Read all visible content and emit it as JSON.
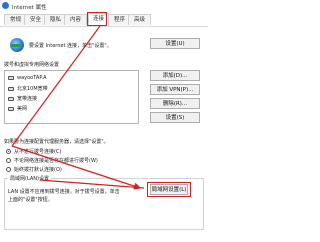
{
  "window": {
    "title": "Internet 属性"
  },
  "tabs": [
    {
      "label": "常规",
      "active": false
    },
    {
      "label": "安全",
      "active": false
    },
    {
      "label": "隐私",
      "active": false
    },
    {
      "label": "内容",
      "active": false
    },
    {
      "label": "连接",
      "active": true
    },
    {
      "label": "程序",
      "active": false
    },
    {
      "label": "高级",
      "active": false
    }
  ],
  "setup": {
    "text": "要设置 Internet 连接，单击\"设置\"。",
    "button": "设置(U)"
  },
  "dialup": {
    "label": "拨号和虚拟专用网络设置",
    "items": [
      "wayooTAP.A",
      "北京10M宽带",
      "宽带连接",
      "美网"
    ],
    "buttons": [
      "添加(D)...",
      "添加 VPN(P)...",
      "删除(R)...",
      "设置(S)"
    ]
  },
  "proxy_note": "如果要为连接配置代理服务器，请选择\"设置\"。",
  "radios": [
    {
      "label": "从不进行拨号连接(C)",
      "checked": true
    },
    {
      "label": "不论网络连接是否存在都进行拨号(W)",
      "checked": false
    },
    {
      "label": "始终拨打默认连接(O)",
      "checked": false
    }
  ],
  "lan": {
    "group_title": "局域网(LAN)设置",
    "text_line1": "LAN 设置不应用到拨号连接。对于拨号设置，单击",
    "text_line2": "上面的\"设置\"按钮。",
    "button": "局域网设置(L)"
  },
  "colors": {
    "highlight": "#d32020"
  }
}
